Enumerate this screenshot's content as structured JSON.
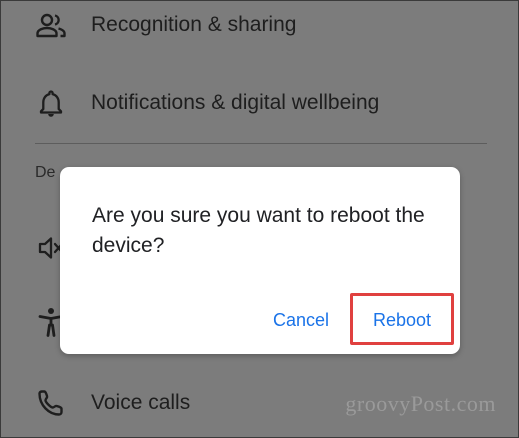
{
  "settings_list": {
    "items": [
      {
        "label": "Recognition & sharing",
        "icon": "people-icon"
      },
      {
        "label": "Notifications & digital wellbeing",
        "icon": "bell-icon"
      },
      {
        "label": "",
        "icon": "volume-icon"
      },
      {
        "label": "",
        "icon": "accessibility-icon"
      },
      {
        "label": "Voice calls",
        "icon": "phone-icon"
      }
    ],
    "section_header": "De"
  },
  "dialog": {
    "message": "Are you sure you want to reboot the device?",
    "cancel_label": "Cancel",
    "reboot_label": "Reboot"
  },
  "watermark": "groovyPost.com",
  "colors": {
    "accent": "#1a73e8",
    "highlight": "#e0403f",
    "scrim": "#7c7c7c",
    "dialog_bg": "#ffffff"
  }
}
